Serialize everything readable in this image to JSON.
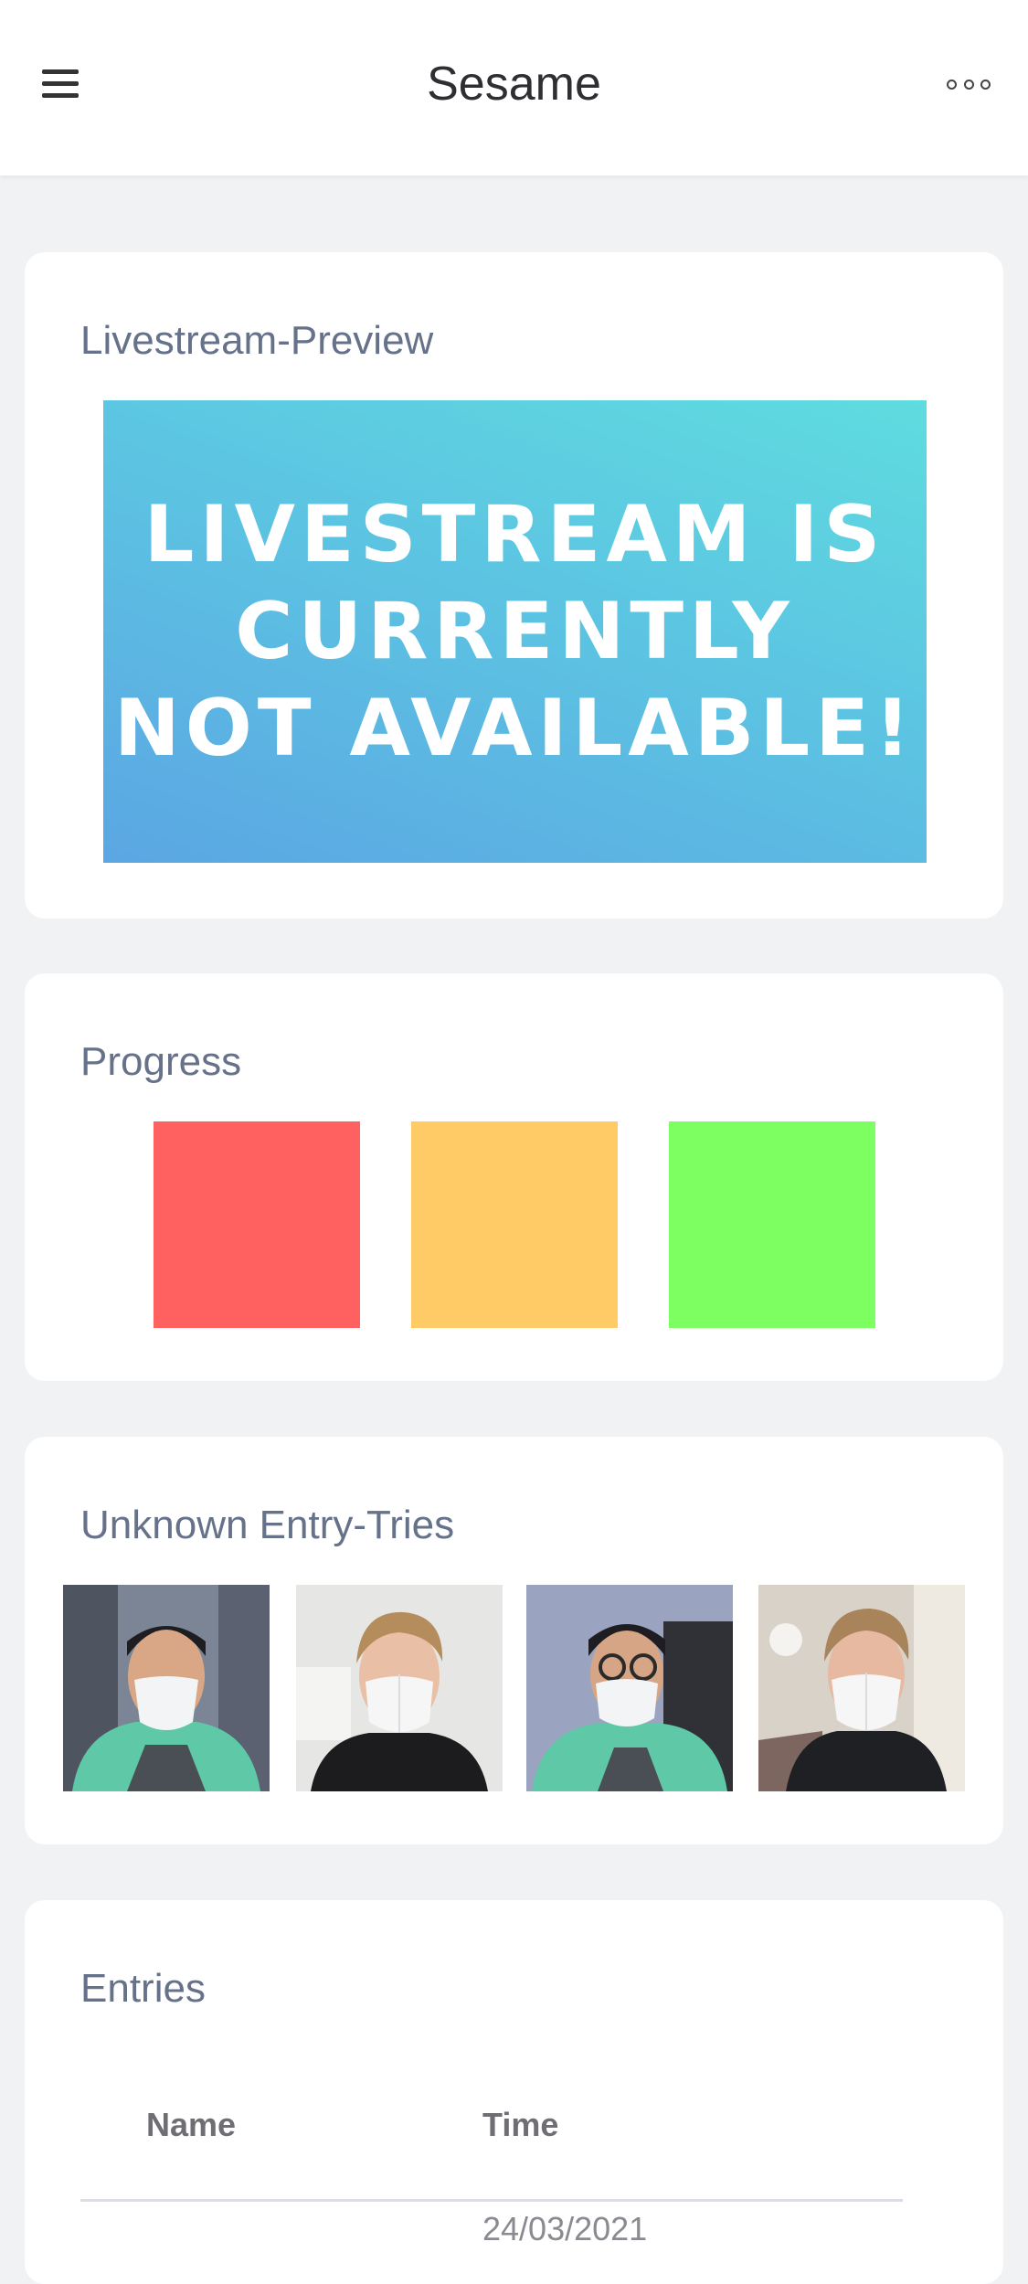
{
  "header": {
    "title": "Sesame",
    "menu_icon": "hamburger-menu-icon",
    "more_icon": "more-options-icon"
  },
  "livestream": {
    "title": "Livestream-Preview",
    "banner_text": "LIVESTREAM IS\nCURRENTLY\nNOT AVAILABLE!"
  },
  "progress": {
    "title": "Progress",
    "colors": [
      "#ff6161",
      "#ffcb66",
      "#7dff62"
    ]
  },
  "unknown_entries": {
    "title": "Unknown Entry-Tries",
    "count": 4
  },
  "entries": {
    "title": "Entries",
    "columns": [
      "Name",
      "Time"
    ],
    "rows": [
      {
        "name": "",
        "time": "24/03/2021"
      }
    ]
  }
}
